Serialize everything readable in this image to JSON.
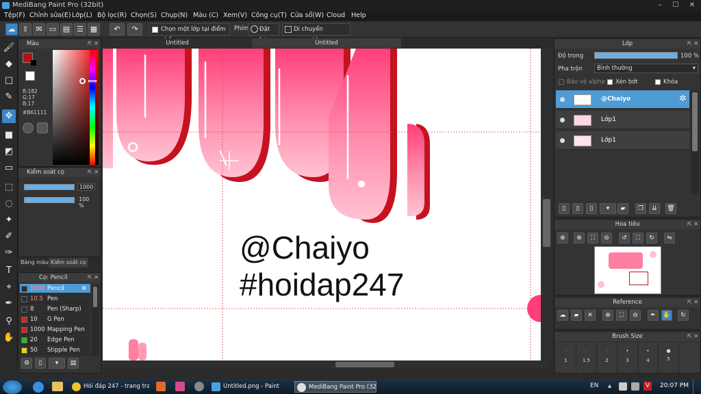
{
  "window": {
    "title": "MediBang Paint Pro (32bit)",
    "controls": [
      "–",
      "☐",
      "✕"
    ]
  },
  "menu": [
    "Tệp(F)",
    "Chỉnh sửa(E)",
    "Lớp(L)",
    "Bộ lọc(R)",
    "Chọn(S)",
    "Chụp(N)",
    "Màu (C)",
    "Xem(V)",
    "Công cụ(T)",
    "Cửa sổ(W)",
    "Cloud",
    "Help"
  ],
  "toolbar": {
    "select_layer_label": "Chọn một lớp tại điểm nhấp",
    "phim_label": "Phím",
    "reset_label": "Đặt lại",
    "move_label": "Di chuyển ngang/dọc"
  },
  "color_panel": {
    "title": "Màu",
    "fg_color": "#B61111",
    "r": "R:182",
    "g": "G:17",
    "b": "B:17",
    "hex": "#B61111"
  },
  "brush_control": {
    "title": "Kiểm soát cọ",
    "size_value": "1000",
    "opacity_value": "100 %",
    "tab_color": "Bảng màu",
    "tab_brush": "Kiểm soát cọ"
  },
  "brush_list": {
    "title": "Cọ: Pencil",
    "items": [
      {
        "size": "1000",
        "name": "Pencil",
        "color": "#2e2e2e"
      },
      {
        "size": "10.5",
        "name": "Pen",
        "color": "#2e2e2e"
      },
      {
        "size": "8",
        "name": "Pen (Sharp)",
        "color": "#2e2e2e"
      },
      {
        "size": "10",
        "name": "G Pen",
        "color": "#e02020"
      },
      {
        "size": "1000",
        "name": "Mapping Pen",
        "color": "#e02020"
      },
      {
        "size": "20",
        "name": "Edge Pen",
        "color": "#2db82d"
      },
      {
        "size": "50",
        "name": "Stipple Pen",
        "color": "#e8d21d"
      }
    ]
  },
  "document_tabs": [
    "Untitled",
    "Untitled"
  ],
  "canvas_text": {
    "line1": "@Chaiyo",
    "line2": "#hoidap247"
  },
  "layer_panel": {
    "title": "Lớp",
    "opacity_label": "Độ trong",
    "opacity_value": "100 %",
    "blend_label": "Pha trộn",
    "blend_value": "Bình thường",
    "protect_alpha": "Bảo vệ alpha",
    "clipping": "Xén bớt",
    "lock": "Khóa",
    "layers": [
      {
        "name": "@Chaiyo",
        "selected": true
      },
      {
        "name": "Lớp1",
        "selected": false
      },
      {
        "name": "Lớp1",
        "selected": false
      }
    ]
  },
  "navigator": {
    "title": "Hoa tiêu"
  },
  "reference": {
    "title": "Reference"
  },
  "brush_size": {
    "title": "Brush Size",
    "sizes": [
      "1",
      "1.5",
      "2",
      "3",
      "4",
      "5"
    ]
  },
  "taskbar": {
    "items": [
      {
        "label": "Hỏi đáp 247 - trang tra ...",
        "color": "#f2c12e"
      },
      {
        "label": "Untitled.png - Paint",
        "color": "#4aa3df"
      },
      {
        "label": "MediBang Paint Pro (32...",
        "color": "#e0e0e0"
      }
    ],
    "lang": "EN",
    "time": "20:07 PM"
  }
}
